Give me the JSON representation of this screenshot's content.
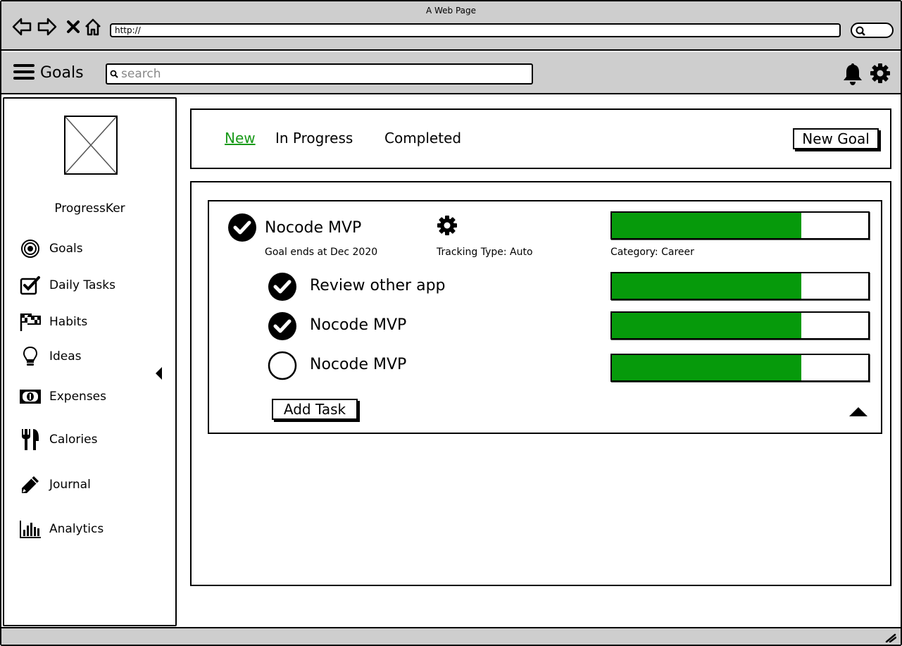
{
  "browser": {
    "title": "A Web Page",
    "url": "http://"
  },
  "app_bar": {
    "title": "Goals",
    "search_placeholder": "search"
  },
  "sidebar": {
    "brand": "ProgressKer",
    "items": [
      {
        "label": "Goals",
        "icon": "target-icon"
      },
      {
        "label": "Daily Tasks",
        "icon": "checkbox-icon"
      },
      {
        "label": "Habits",
        "icon": "flags-icon"
      },
      {
        "label": "Ideas",
        "icon": "lightbulb-icon"
      },
      {
        "label": "Expenses",
        "icon": "money-icon"
      },
      {
        "label": "Calories",
        "icon": "cutlery-icon"
      },
      {
        "label": "Journal",
        "icon": "pencil-icon"
      },
      {
        "label": "Analytics",
        "icon": "bar-chart-icon"
      }
    ]
  },
  "tabs": {
    "items": [
      "New",
      "In Progress",
      "Completed"
    ],
    "active": "New",
    "new_goal_label": "New Goal"
  },
  "goal": {
    "title": "Nocode MVP",
    "completed": true,
    "ends": "Goal ends at Dec 2020",
    "tracking": "Tracking Type: Auto",
    "category": "Category: Career",
    "progress": 0.74,
    "tasks": [
      {
        "title": "Review other app",
        "completed": true,
        "progress": 0.74
      },
      {
        "title": "Nocode MVP",
        "completed": true,
        "progress": 0.74
      },
      {
        "title": "Nocode MVP",
        "completed": false,
        "progress": 0.74
      }
    ],
    "add_task_label": "Add Task"
  },
  "colors": {
    "accent": "#1a9a1a",
    "progress_fill": "#069a0b",
    "chrome": "#cecece"
  }
}
